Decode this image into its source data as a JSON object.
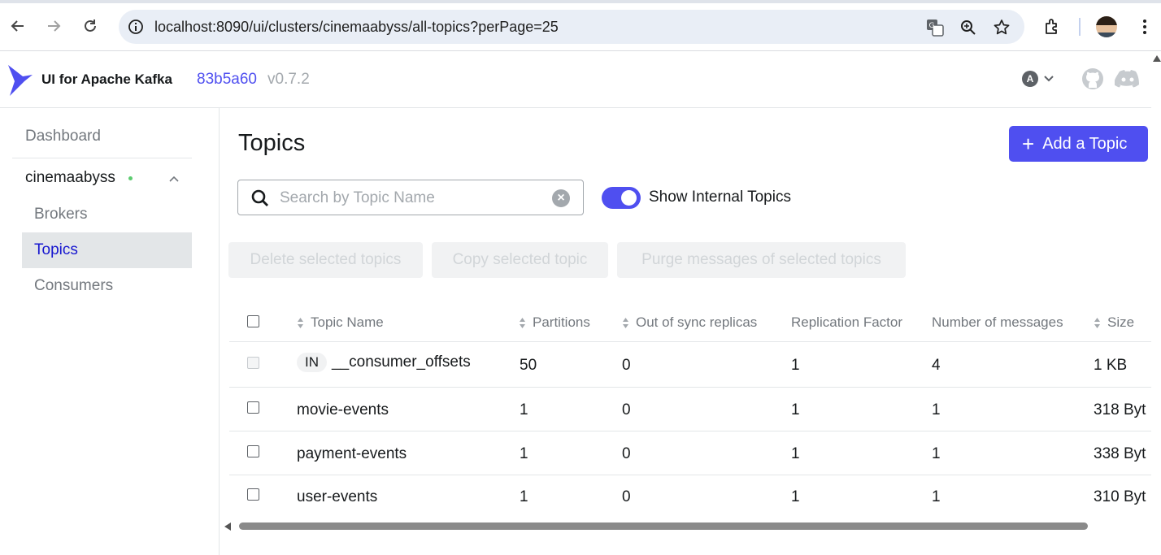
{
  "browser": {
    "url": "localhost:8090/ui/clusters/cinemaabyss/all-topics?perPage=25"
  },
  "header": {
    "brand": "UI for Apache Kafka",
    "commit": "83b5a60",
    "version": "v0.7.2",
    "user_initial": "A"
  },
  "sidebar": {
    "dashboard": "Dashboard",
    "cluster": "cinemaabyss",
    "items": [
      {
        "label": "Brokers",
        "active": false
      },
      {
        "label": "Topics",
        "active": true
      },
      {
        "label": "Consumers",
        "active": false
      }
    ]
  },
  "main": {
    "title": "Topics",
    "add_button": "Add a Topic",
    "search_placeholder": "Search by Topic Name",
    "toggle_label": "Show Internal Topics",
    "toggle_on": true,
    "bulk_actions": [
      "Delete selected topics",
      "Copy selected topic",
      "Purge messages of selected topics"
    ]
  },
  "table": {
    "columns": [
      "Topic Name",
      "Partitions",
      "Out of sync replicas",
      "Replication Factor",
      "Number of messages",
      "Size"
    ],
    "internal_tag": "IN",
    "rows": [
      {
        "name": "__consumer_offsets",
        "internal": true,
        "partitions": "50",
        "out_of_sync": "0",
        "replication": "1",
        "messages": "4",
        "size": "1 KB"
      },
      {
        "name": "movie-events",
        "internal": false,
        "partitions": "1",
        "out_of_sync": "0",
        "replication": "1",
        "messages": "1",
        "size": "318 Byt"
      },
      {
        "name": "payment-events",
        "internal": false,
        "partitions": "1",
        "out_of_sync": "0",
        "replication": "1",
        "messages": "1",
        "size": "338 Byt"
      },
      {
        "name": "user-events",
        "internal": false,
        "partitions": "1",
        "out_of_sync": "0",
        "replication": "1",
        "messages": "1",
        "size": "310 Byt"
      }
    ]
  },
  "colors": {
    "accent": "#4f4ff0",
    "active_nav": "#1717cf",
    "online_dot": "#5ccc6f"
  }
}
